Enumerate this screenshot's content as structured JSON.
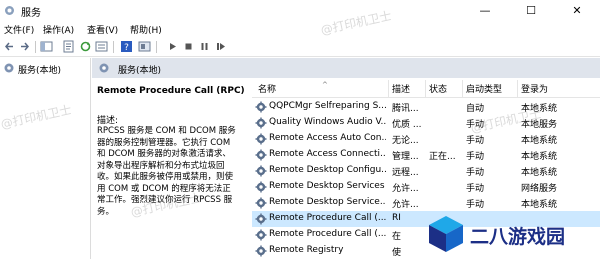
{
  "window": {
    "title": "服务",
    "minimize": "—",
    "maximize": "☐",
    "close": "✕"
  },
  "menu": [
    "文件(F)",
    "操作(A)",
    "查看(V)",
    "帮助(H)"
  ],
  "tree": {
    "root": "服务(本地)"
  },
  "pane_header": "服务(本地)",
  "detail": {
    "service_title": "Remote Procedure Call (RPC)",
    "desc_label": "描述:",
    "desc_lines": [
      "RPCSS 服务是 COM 和 DCOM 服务",
      "器的服务控制管理器。它执行 COM",
      "和 DCOM 服务器的对象激活请求、",
      "对象导出程序解析和分布式垃圾回",
      "收。如果此服务被停用或禁用，则使",
      "用 COM 或 DCOM 的程序将无法正",
      "常工作。强烈建议你运行 RPCSS 服务。"
    ]
  },
  "columns": {
    "name": "名称",
    "description": "描述",
    "status": "状态",
    "startup": "启动类型",
    "logon": "登录为"
  },
  "rows": [
    {
      "name": "QQPCMgr Selfreparing S...",
      "desc": "腾讯...",
      "status": "",
      "startup": "自动",
      "logon": "本地系统"
    },
    {
      "name": "Quality Windows Audio V...",
      "desc": "优质 ...",
      "status": "",
      "startup": "手动",
      "logon": "本地服务"
    },
    {
      "name": "Remote Access Auto Con...",
      "desc": "无论...",
      "status": "",
      "startup": "手动",
      "logon": "本地系统"
    },
    {
      "name": "Remote Access Connecti...",
      "desc": "管理...",
      "status": "正在...",
      "startup": "手动",
      "logon": "本地系统"
    },
    {
      "name": "Remote Desktop Configu...",
      "desc": "远程...",
      "status": "",
      "startup": "手动",
      "logon": "本地系统"
    },
    {
      "name": "Remote Desktop Services",
      "desc": "允许...",
      "status": "",
      "startup": "手动",
      "logon": "网络服务"
    },
    {
      "name": "Remote Desktop Service...",
      "desc": "允许...",
      "status": "",
      "startup": "手动",
      "logon": "本地系统"
    },
    {
      "name": "Remote Procedure Call (...",
      "desc": "RI",
      "status": "",
      "startup": "",
      "logon": ""
    },
    {
      "name": "Remote Procedure Call (...",
      "desc": "在",
      "status": "",
      "startup": "",
      "logon": ""
    },
    {
      "name": "Remote Registry",
      "desc": "使",
      "status": "",
      "startup": "",
      "logon": ""
    }
  ],
  "selected_row": 7,
  "watermark": "@打印机卫士",
  "logo_text": "二八游戏园",
  "colors": {
    "selection": "#cce8ff",
    "header_band": "#dfe4ec",
    "gear": "#5a6f8c",
    "logo": "#1c2f86"
  }
}
